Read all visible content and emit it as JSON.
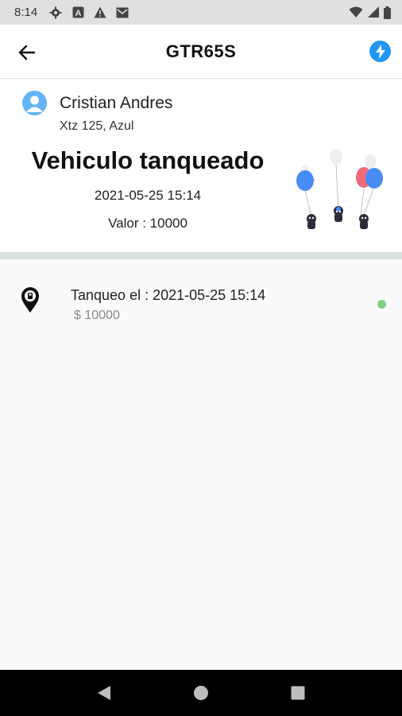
{
  "status_bar": {
    "time": "8:14",
    "icons": [
      "settings-icon",
      "a-icon",
      "warning-icon",
      "mail-icon"
    ],
    "right_icons": [
      "wifi-icon",
      "signal-icon",
      "battery-icon"
    ]
  },
  "app_bar": {
    "title": "GTR65S",
    "back_icon": "arrow-left-icon",
    "action_icon": "flash-icon",
    "accent": "#2196f3"
  },
  "summary": {
    "user_name": "Cristian Andres",
    "vehicle": "Xtz 125, Azul",
    "headline": "Vehiculo tanqueado",
    "date": "2021-05-25 15:14",
    "value_text": "Valor : 10000"
  },
  "list": {
    "items": [
      {
        "title": "Tanqueo el : 2021-05-25 15:14",
        "amount": "$ 10000",
        "status_color": "#7ed087"
      }
    ]
  },
  "nav": {
    "buttons": [
      "back-nav-icon",
      "home-nav-icon",
      "recents-nav-icon"
    ]
  }
}
